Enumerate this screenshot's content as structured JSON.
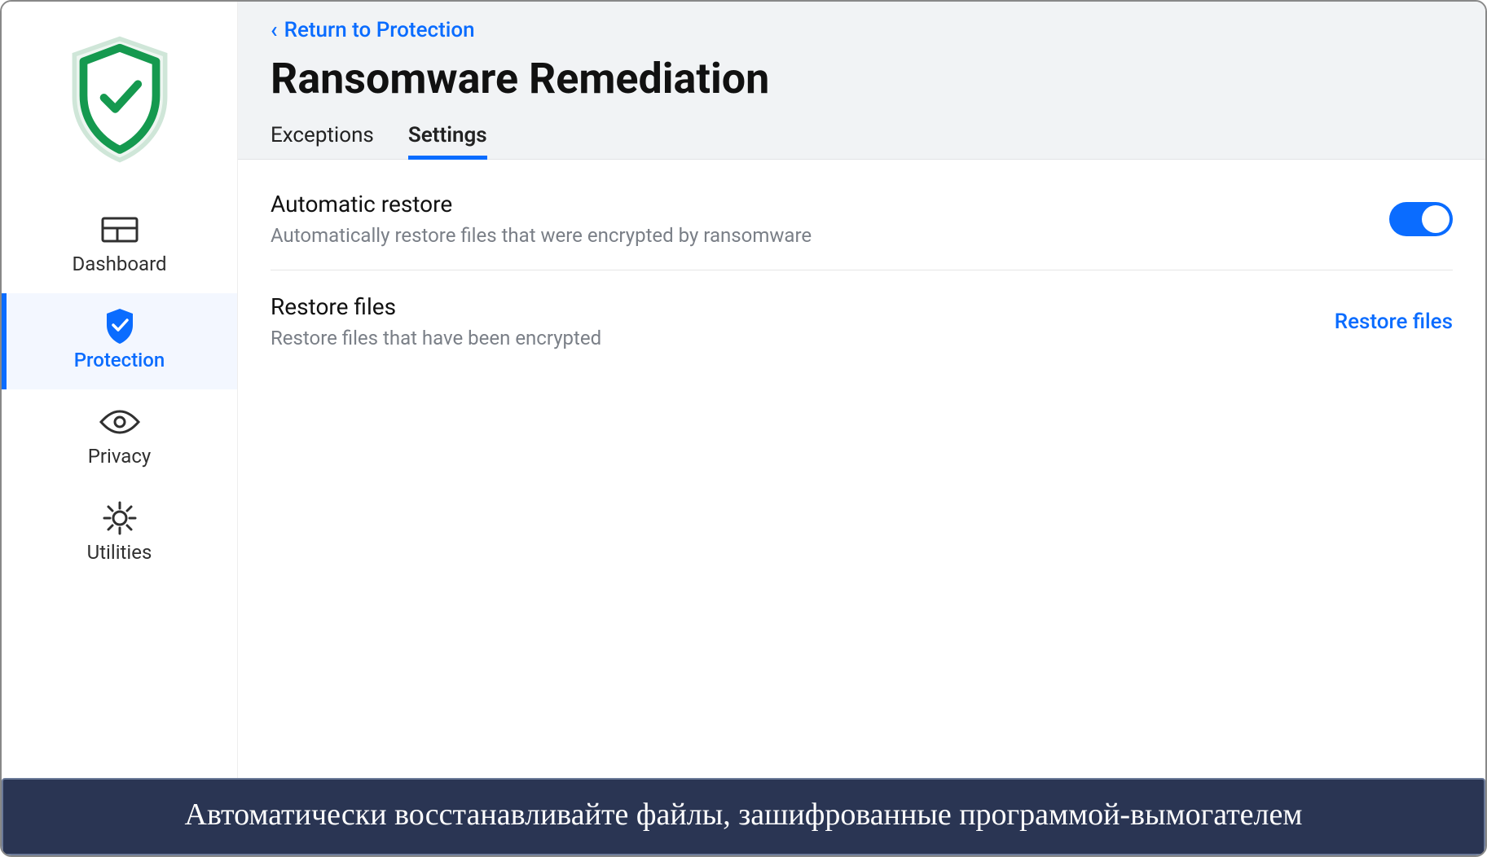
{
  "sidebar": {
    "items": [
      {
        "id": "dashboard",
        "label": "Dashboard",
        "icon": "dashboard-icon",
        "active": false
      },
      {
        "id": "protection",
        "label": "Protection",
        "icon": "shield-icon",
        "active": true
      },
      {
        "id": "privacy",
        "label": "Privacy",
        "icon": "eye-icon",
        "active": false
      },
      {
        "id": "utilities",
        "label": "Utilities",
        "icon": "gear-icon",
        "active": false
      }
    ]
  },
  "header": {
    "back_label": "Return to Protection",
    "title": "Ransomware Remediation",
    "tabs": [
      {
        "id": "exceptions",
        "label": "Exceptions",
        "active": false
      },
      {
        "id": "settings",
        "label": "Settings",
        "active": true
      }
    ]
  },
  "settings": {
    "auto_restore": {
      "title": "Automatic restore",
      "description": "Automatically restore files that were encrypted by ransomware",
      "enabled": true
    },
    "restore_files": {
      "title": "Restore files",
      "description": "Restore files that have been encrypted",
      "action_label": "Restore files"
    }
  },
  "caption": "Автоматически восстанавливайте файлы, зашифрованные программой-вымогателем",
  "colors": {
    "accent": "#0a6cff",
    "brand_green": "#15994f",
    "banner_bg": "#2a3553"
  }
}
